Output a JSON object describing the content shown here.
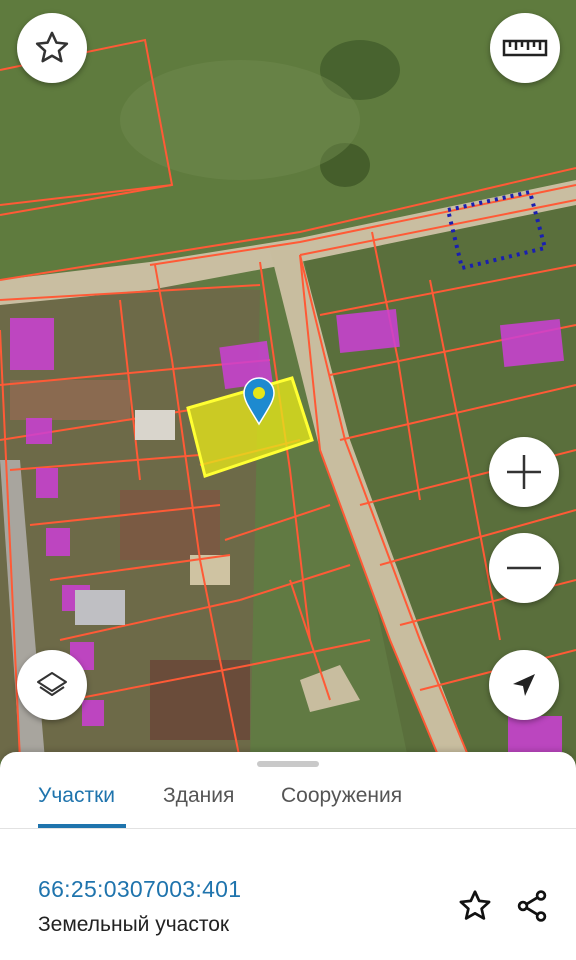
{
  "map": {
    "selected_parcel_color": "#e6e51a",
    "boundary_color": "#ff5a36",
    "building_color": "#cc3fd6",
    "marker_color": "#1d8ad0"
  },
  "controls": {
    "favorite_icon": "star-outline-icon",
    "ruler_icon": "ruler-icon",
    "zoom_in_icon": "plus-icon",
    "zoom_out_icon": "minus-icon",
    "layers_icon": "layers-icon",
    "location_icon": "navigation-arrow-icon"
  },
  "tabs": [
    {
      "label": "Участки",
      "active": true
    },
    {
      "label": "Здания",
      "active": false
    },
    {
      "label": "Сооружения",
      "active": false
    }
  ],
  "parcel": {
    "cadastral_number": "66:25:0307003:401",
    "type": "Земельный участок"
  },
  "accent_color": "#1f74ad"
}
